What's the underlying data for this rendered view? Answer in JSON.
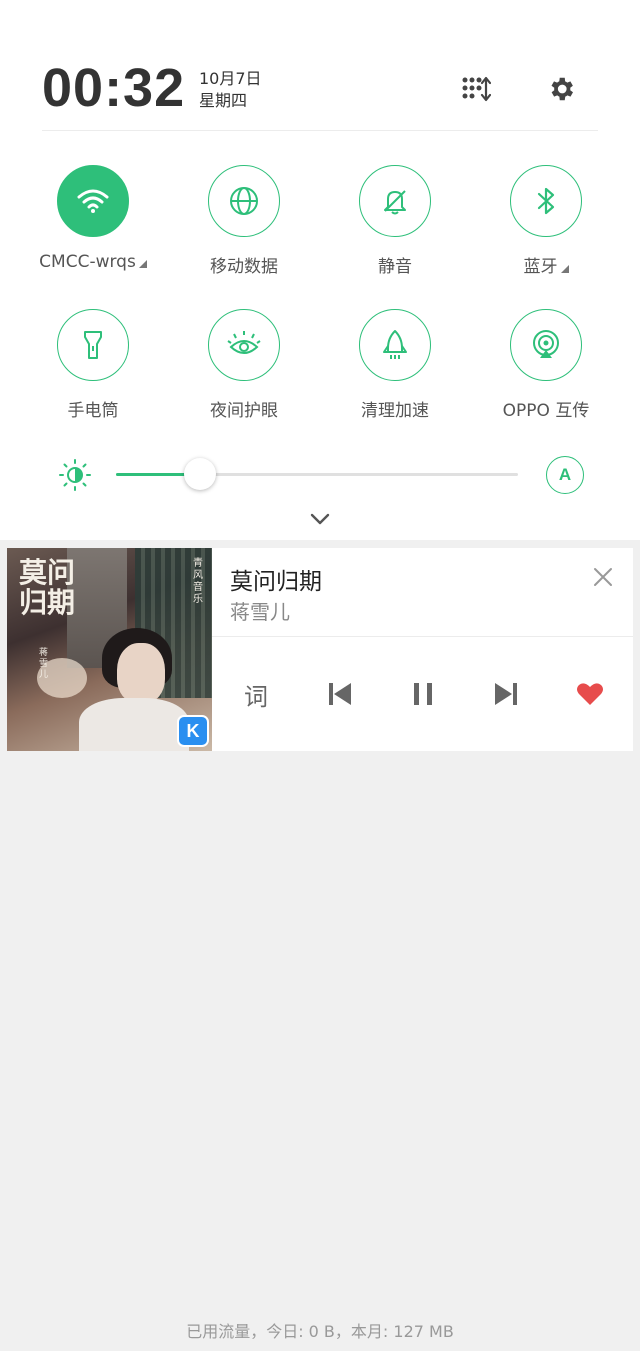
{
  "status": {
    "time": "00:32",
    "date": "10月7日",
    "weekday": "星期四"
  },
  "header_icons": [
    "edit-tiles-icon",
    "gear-icon"
  ],
  "accent_color": "#2ebf7a",
  "tiles": [
    {
      "label": "CMCC-wrqs",
      "icon": "wifi-icon",
      "active": true,
      "has_expand": true
    },
    {
      "label": "移动数据",
      "icon": "globe-icon",
      "active": false,
      "has_expand": false
    },
    {
      "label": "静音",
      "icon": "bell-off-icon",
      "active": false,
      "has_expand": false
    },
    {
      "label": "蓝牙",
      "icon": "bluetooth-icon",
      "active": false,
      "has_expand": true
    },
    {
      "label": "手电筒",
      "icon": "flashlight-icon",
      "active": false,
      "has_expand": false
    },
    {
      "label": "夜间护眼",
      "icon": "eye-icon",
      "active": false,
      "has_expand": false
    },
    {
      "label": "清理加速",
      "icon": "rocket-icon",
      "active": false,
      "has_expand": false
    },
    {
      "label": "OPPO 互传",
      "icon": "share-icon",
      "active": false,
      "has_expand": false
    }
  ],
  "brightness": {
    "level": 0.21,
    "auto_label": "A"
  },
  "music": {
    "title": "莫问归期",
    "artist": "蒋雪儿",
    "cover_text": {
      "title": "莫问归期",
      "side": "青风音乐",
      "singer": "蒋雪儿"
    },
    "lyric_label": "词",
    "liked": true,
    "app_badge": "K"
  },
  "footer": {
    "data_usage": "已用流量，今日: 0 B，本月: 127 MB"
  }
}
